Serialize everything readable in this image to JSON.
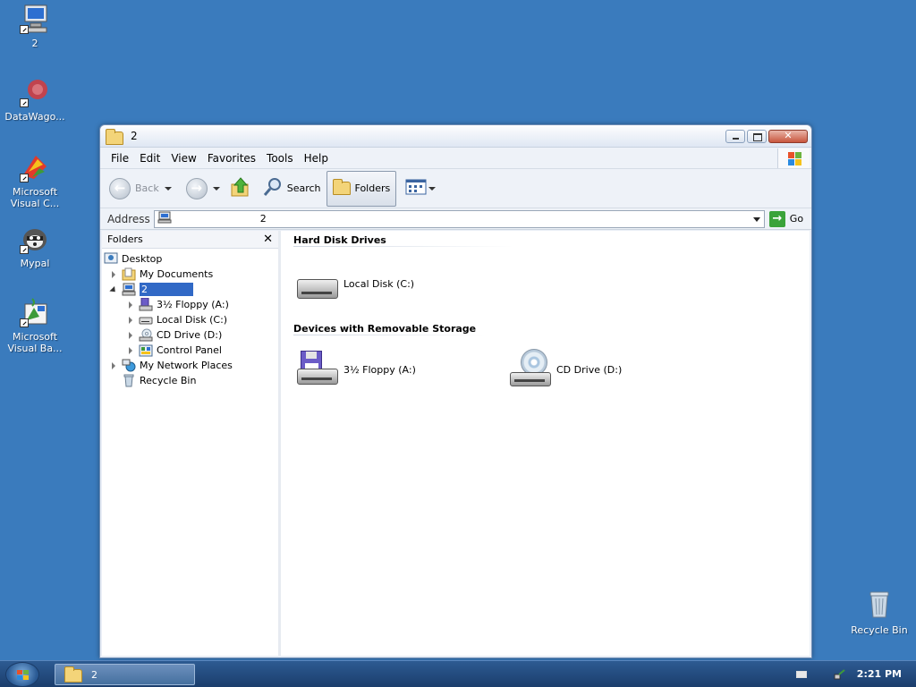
{
  "desktop": {
    "icons": [
      {
        "label": "2",
        "icon": "computer-icon"
      },
      {
        "label": "DataWago...",
        "icon": "datawagon-icon"
      },
      {
        "label": "Microsoft Visual C...",
        "icon": "visual-c-icon"
      },
      {
        "label": "Mypal",
        "icon": "mypal-icon"
      },
      {
        "label": "Microsoft Visual Ba...",
        "icon": "visual-basic-icon"
      }
    ],
    "recycle_bin": "Recycle Bin"
  },
  "window": {
    "title": "2",
    "menu": [
      "File",
      "Edit",
      "View",
      "Favorites",
      "Tools",
      "Help"
    ],
    "toolbar": {
      "back": "Back",
      "search": "Search",
      "folders": "Folders"
    },
    "address": {
      "label": "Address",
      "value": "2",
      "go": "Go"
    },
    "folders_pane": {
      "title": "Folders",
      "tree": [
        {
          "label": "Desktop",
          "icon": "desktop-icon"
        },
        {
          "label": "My Documents",
          "icon": "my-documents-icon"
        },
        {
          "label": "2",
          "icon": "computer-icon"
        },
        {
          "label": "3½ Floppy (A:)",
          "icon": "floppy-icon"
        },
        {
          "label": "Local Disk (C:)",
          "icon": "hard-disk-icon"
        },
        {
          "label": "CD Drive (D:)",
          "icon": "cd-drive-icon"
        },
        {
          "label": "Control Panel",
          "icon": "control-panel-icon"
        },
        {
          "label": "My Network Places",
          "icon": "network-icon"
        },
        {
          "label": "Recycle Bin",
          "icon": "recycle-bin-icon"
        }
      ]
    },
    "main": {
      "groups": [
        {
          "title": "Hard Disk Drives",
          "items": [
            {
              "label": "Local Disk (C:)"
            }
          ]
        },
        {
          "title": "Devices with Removable Storage",
          "items": [
            {
              "label": "3½ Floppy (A:)"
            },
            {
              "label": "CD Drive (D:)"
            }
          ]
        }
      ]
    }
  },
  "taskbar": {
    "task": "2",
    "clock": "2:21 PM"
  },
  "colors": {
    "desktop": "#3a7bbd",
    "selection": "#3169c6"
  }
}
